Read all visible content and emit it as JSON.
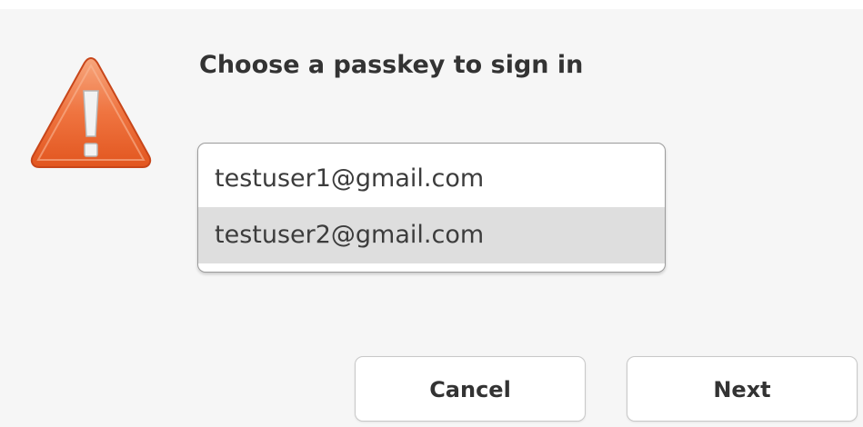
{
  "dialog": {
    "title": "Choose a passkey to sign in",
    "icon": "warning-icon",
    "accounts": [
      "testuser1@gmail.com",
      "testuser2@gmail.com"
    ],
    "selected_index": 1,
    "buttons": {
      "cancel_label": "Cancel",
      "next_label": "Next"
    },
    "colors": {
      "warning_orange": "#e8592a",
      "selected_row": "#dedede",
      "background": "#f6f6f6"
    }
  }
}
